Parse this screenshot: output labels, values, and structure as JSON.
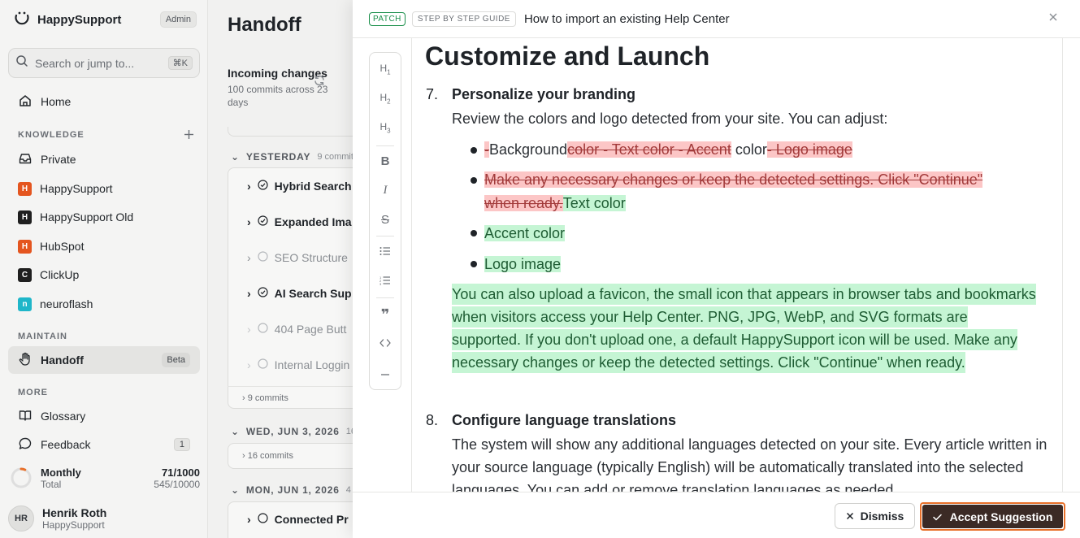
{
  "sidebar": {
    "brand": "HappySupport",
    "admin_badge": "Admin",
    "search_placeholder": "Search or jump to...",
    "search_shortcut": "⌘K",
    "home": "Home",
    "knowledge_label": "KNOWLEDGE",
    "workspaces": [
      {
        "label": "Private",
        "badge": ""
      },
      {
        "label": "HappySupport",
        "badge": "H",
        "color": "#e4551f"
      },
      {
        "label": "HappySupport Old",
        "badge": "H",
        "color": "#1f1f1f"
      },
      {
        "label": "HubSpot",
        "badge": "H",
        "color": "#e4551f"
      },
      {
        "label": "ClickUp",
        "badge": "C",
        "color": "#1f1f1f"
      },
      {
        "label": "neuroflash",
        "badge": "n",
        "color": "#1fb6c9"
      }
    ],
    "maintain_label": "MAINTAIN",
    "handoff": "Handoff",
    "handoff_badge": "Beta",
    "more_label": "MORE",
    "glossary": "Glossary",
    "feedback": "Feedback",
    "feedback_count": "1",
    "usage": {
      "label": "Monthly",
      "sub": "Total",
      "value": "71/1000",
      "total": "545/10000",
      "fraction": 0.071
    },
    "user": {
      "initials": "HR",
      "name": "Henrik Roth",
      "org": "HappySupport"
    }
  },
  "handoff": {
    "title": "Handoff",
    "incoming_title": "Incoming changes",
    "incoming_sub": "100 commits across 23 days",
    "yesterday_label": "YESTERDAY",
    "yesterday_count": "9 commits",
    "commits": [
      {
        "label": "Hybrid Search",
        "done": true,
        "expandable": true
      },
      {
        "label": "Expanded Ima",
        "done": true,
        "expandable": true
      },
      {
        "label": "SEO Structure",
        "done": false,
        "expandable": true
      },
      {
        "label": "AI Search Sup",
        "done": true,
        "expandable": true
      },
      {
        "label": "404 Page Butt",
        "done": false,
        "expandable": false
      },
      {
        "label": "Internal Loggin",
        "done": false,
        "expandable": false
      }
    ],
    "yesterday_footer": "9 commits",
    "day2_label": "WED, JUN 3, 2026",
    "day2_count": "16",
    "day2_footer": "16 commits",
    "day3_label": "MON, JUN 1, 2026",
    "day3_count": "4",
    "day3_peek": "Connected Pr"
  },
  "modal": {
    "tag_patch": "PATCH",
    "tag_guide": "STEP BY STEP GUIDE",
    "title": "How to import an existing Help Center",
    "heading": "Customize and Launch",
    "step7": {
      "num": "7.",
      "title": "Personalize your branding",
      "intro": "Review the colors and logo detected from your site. You can adjust:",
      "b1_del1": "-",
      "b1_keep1": "Background",
      "b1_del2": "color - Text color - Accent",
      "b1_keep2": " color",
      "b1_del3": "- Logo image",
      "b2_del_a": "Make any necessary changes or keep the detected settings. Click \"Continue\"",
      "b2_del_b": "when ready.",
      "b2_ins": "Text color",
      "b3_ins": "Accent color",
      "b4_ins": "Logo image",
      "favicon_ins": "You can also upload a favicon, the small icon that appears in browser tabs and bookmarks when visitors access your Help Center. PNG, JPG, WebP, and SVG formats are supported. If you don't upload one, a default HappySupport icon will be used. Make any necessary changes or keep the detected settings. Click \"Continue\" when ready."
    },
    "step8": {
      "num": "8.",
      "title": "Configure language translations",
      "text": "The system will show any additional languages detected on your site. Every article written in your source language (typically English) will be automatically translated into the selected languages. You can add or remove translation languages as needed."
    },
    "toolbar": [
      "H1",
      "H2",
      "H3",
      "B",
      "I",
      "S",
      "ul",
      "ol",
      "quote",
      "code",
      "hr"
    ],
    "dismiss": "Dismiss",
    "accept": "Accept Suggestion"
  }
}
